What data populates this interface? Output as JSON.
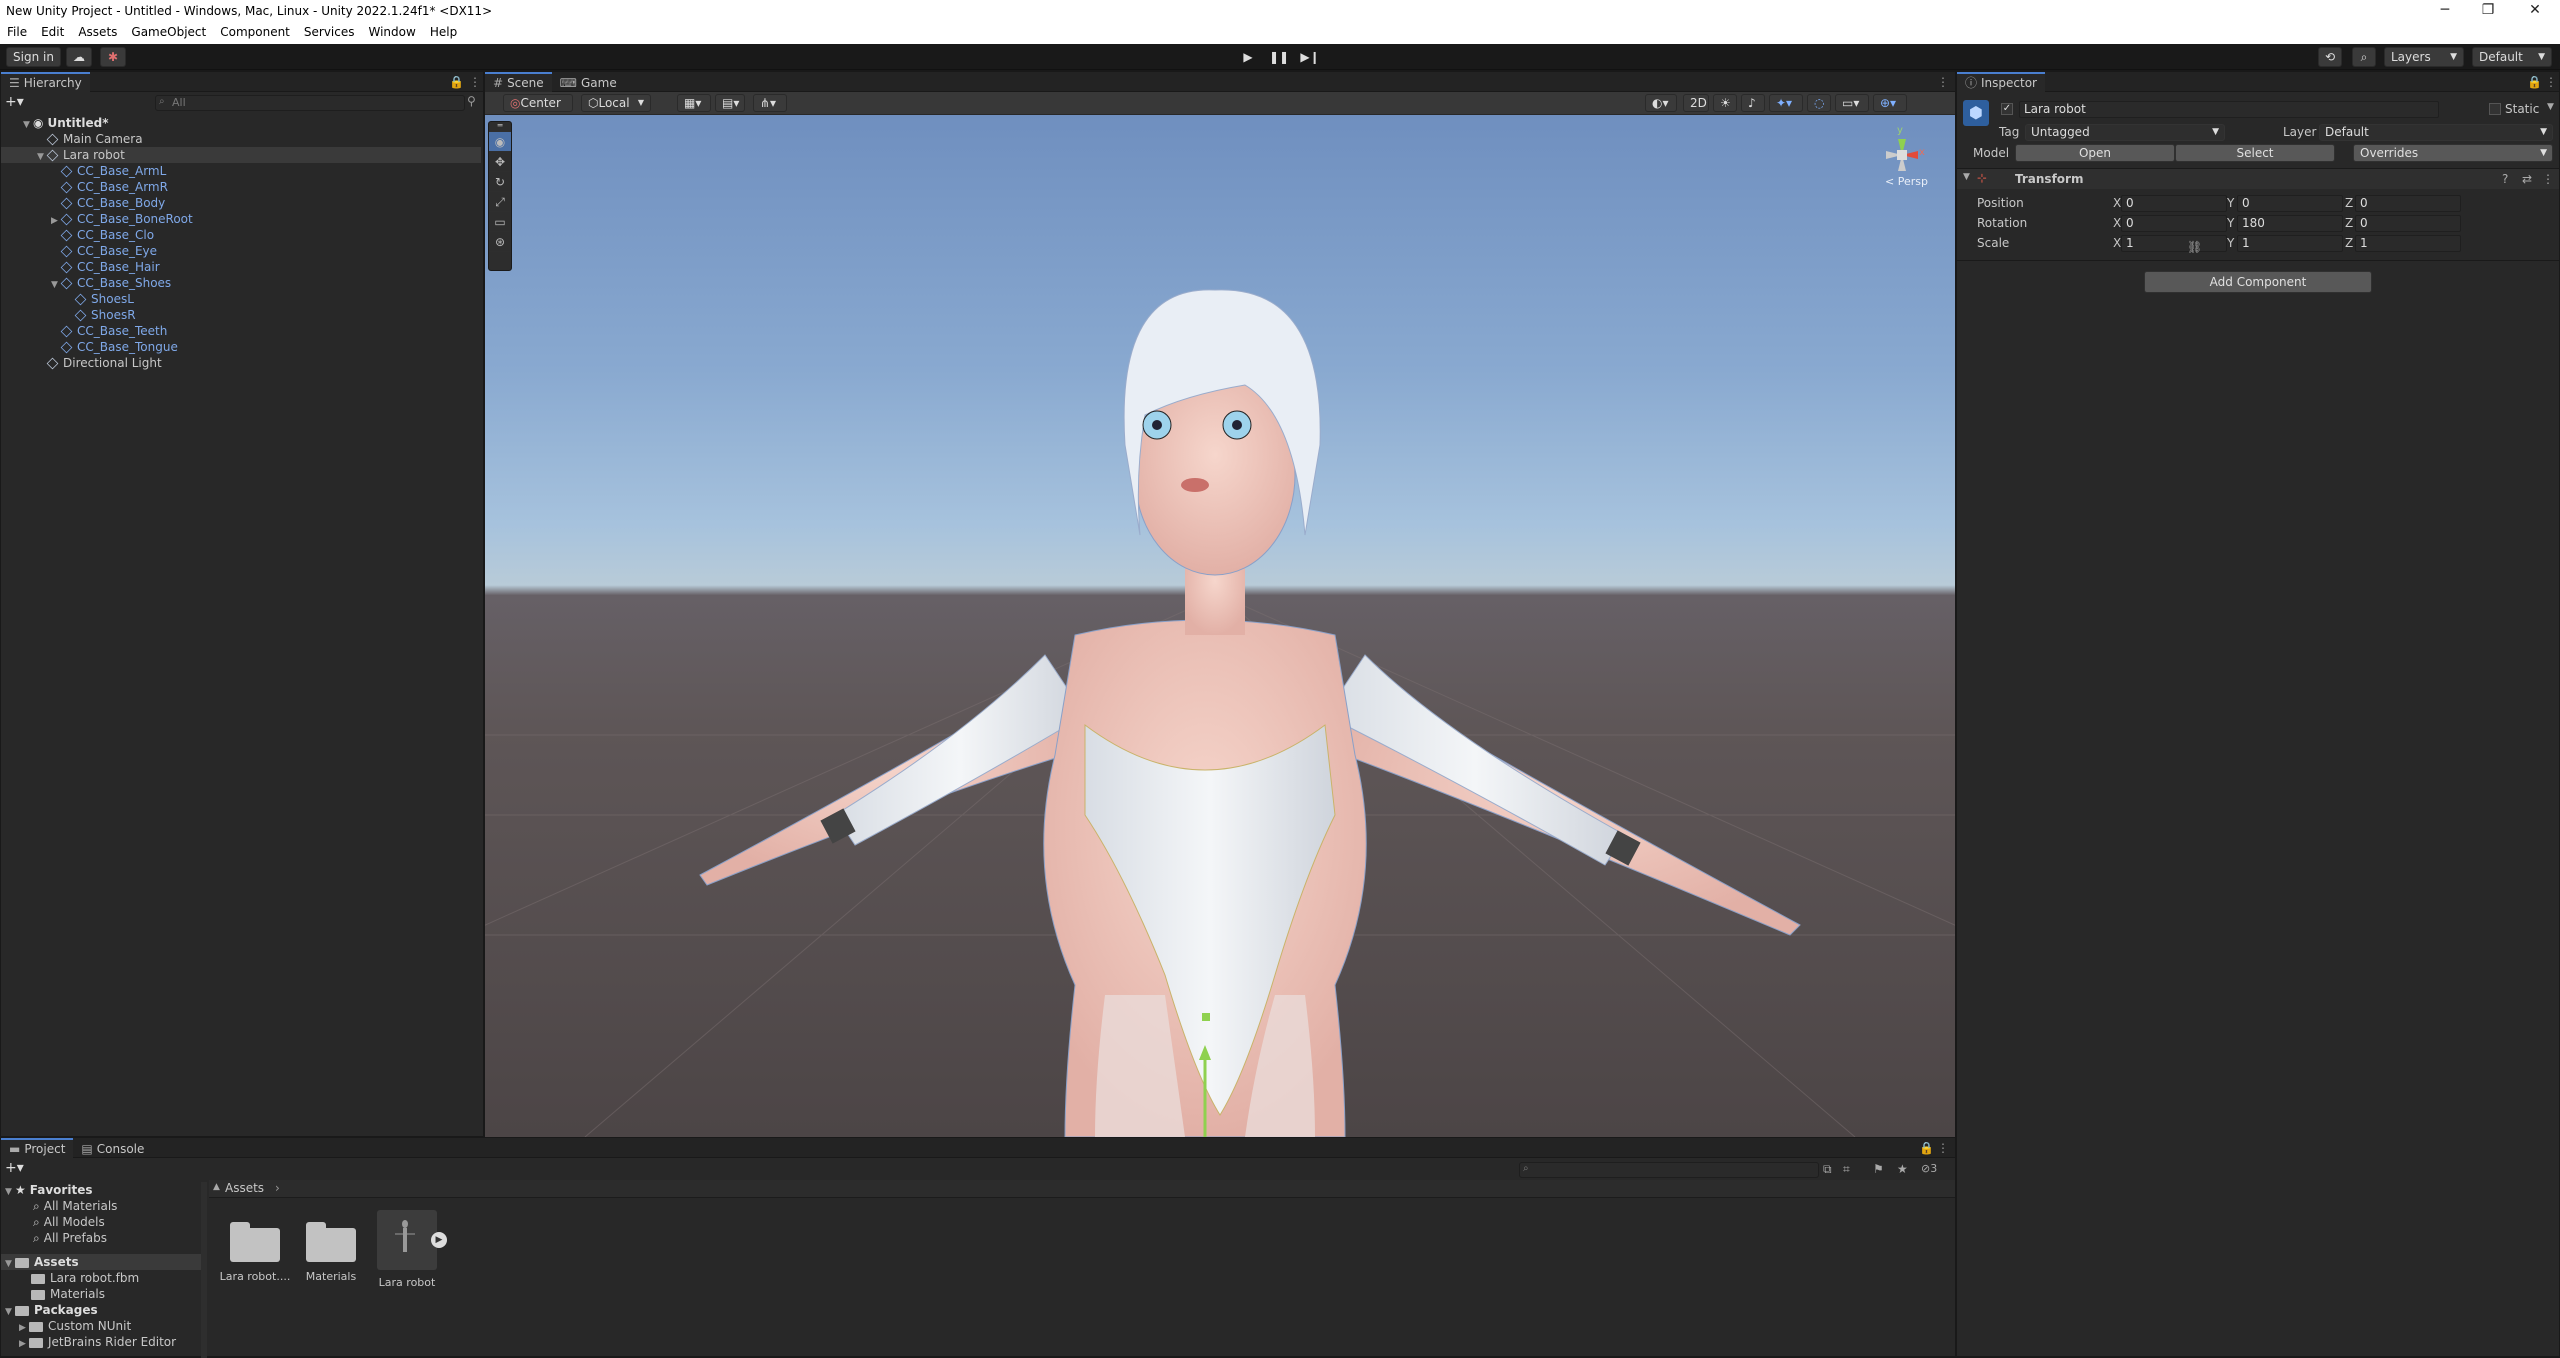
{
  "window": {
    "title": "New Unity Project - Untitled - Windows, Mac, Linux - Unity 2022.1.24f1* <DX11>",
    "minimize": "─",
    "restore": "❐",
    "close": "✕"
  },
  "menu": [
    "File",
    "Edit",
    "Assets",
    "GameObject",
    "Component",
    "Services",
    "Window",
    "Help"
  ],
  "toolbar": {
    "sign_in": "Sign in",
    "layers": "Layers",
    "layout": "Default"
  },
  "hierarchy": {
    "tab": "Hierarchy",
    "search_placeholder": "All",
    "scene": "Untitled*",
    "items": [
      {
        "label": "Main Camera",
        "depth": 1,
        "prefab": false,
        "arrow": ""
      },
      {
        "label": "Lara robot",
        "depth": 1,
        "prefab": false,
        "arrow": "▼",
        "selected": true
      },
      {
        "label": "CC_Base_ArmL",
        "depth": 2,
        "prefab": true,
        "arrow": ""
      },
      {
        "label": "CC_Base_ArmR",
        "depth": 2,
        "prefab": true,
        "arrow": ""
      },
      {
        "label": "CC_Base_Body",
        "depth": 2,
        "prefab": true,
        "arrow": ""
      },
      {
        "label": "CC_Base_BoneRoot",
        "depth": 2,
        "prefab": true,
        "arrow": "▶"
      },
      {
        "label": "CC_Base_Clo",
        "depth": 2,
        "prefab": true,
        "arrow": ""
      },
      {
        "label": "CC_Base_Eye",
        "depth": 2,
        "prefab": true,
        "arrow": ""
      },
      {
        "label": "CC_Base_Hair",
        "depth": 2,
        "prefab": true,
        "arrow": ""
      },
      {
        "label": "CC_Base_Shoes",
        "depth": 2,
        "prefab": true,
        "arrow": "▼"
      },
      {
        "label": "ShoesL",
        "depth": 3,
        "prefab": true,
        "arrow": ""
      },
      {
        "label": "ShoesR",
        "depth": 3,
        "prefab": true,
        "arrow": ""
      },
      {
        "label": "CC_Base_Teeth",
        "depth": 2,
        "prefab": true,
        "arrow": ""
      },
      {
        "label": "CC_Base_Tongue",
        "depth": 2,
        "prefab": true,
        "arrow": ""
      },
      {
        "label": "Directional Light",
        "depth": 1,
        "prefab": false,
        "arrow": ""
      }
    ]
  },
  "scene": {
    "tab_scene": "Scene",
    "tab_game": "Game",
    "pivot": "Center",
    "space": "Local",
    "mode2d": "2D",
    "persp": "< Persp",
    "gizmo": {
      "y": "y",
      "x": "x",
      "z": "z"
    }
  },
  "inspector": {
    "tab": "Inspector",
    "object_name": "Lara robot",
    "static": "Static",
    "tag_label": "Tag",
    "tag": "Untagged",
    "layer_label": "Layer",
    "layer": "Default",
    "model_label": "Model",
    "open": "Open",
    "select": "Select",
    "overrides": "Overrides",
    "component": "Transform",
    "position": {
      "label": "Position",
      "x": "0",
      "y": "0",
      "z": "0"
    },
    "rotation": {
      "label": "Rotation",
      "x": "0",
      "y": "180",
      "z": "0"
    },
    "scale": {
      "label": "Scale",
      "x": "1",
      "y": "1",
      "z": "1"
    },
    "axis": {
      "x": "X",
      "y": "Y",
      "z": "Z"
    },
    "add_component": "Add Component"
  },
  "project": {
    "tab_project": "Project",
    "tab_console": "Console",
    "favorites": "Favorites",
    "fav_items": [
      "All Materials",
      "All Models",
      "All Prefabs"
    ],
    "assets": "Assets",
    "asset_items": [
      "Lara robot.fbm",
      "Materials"
    ],
    "packages": "Packages",
    "package_items": [
      "Custom NUnit",
      "JetBrains Rider Editor"
    ],
    "breadcrumb": "Assets",
    "grid": [
      "Lara robot....",
      "Materials",
      "Lara robot"
    ],
    "hidden_count": "3"
  },
  "colors": {
    "accent": "#4a7fd0",
    "prefab": "#7fa8e8",
    "selection": "#3a3a3a"
  }
}
